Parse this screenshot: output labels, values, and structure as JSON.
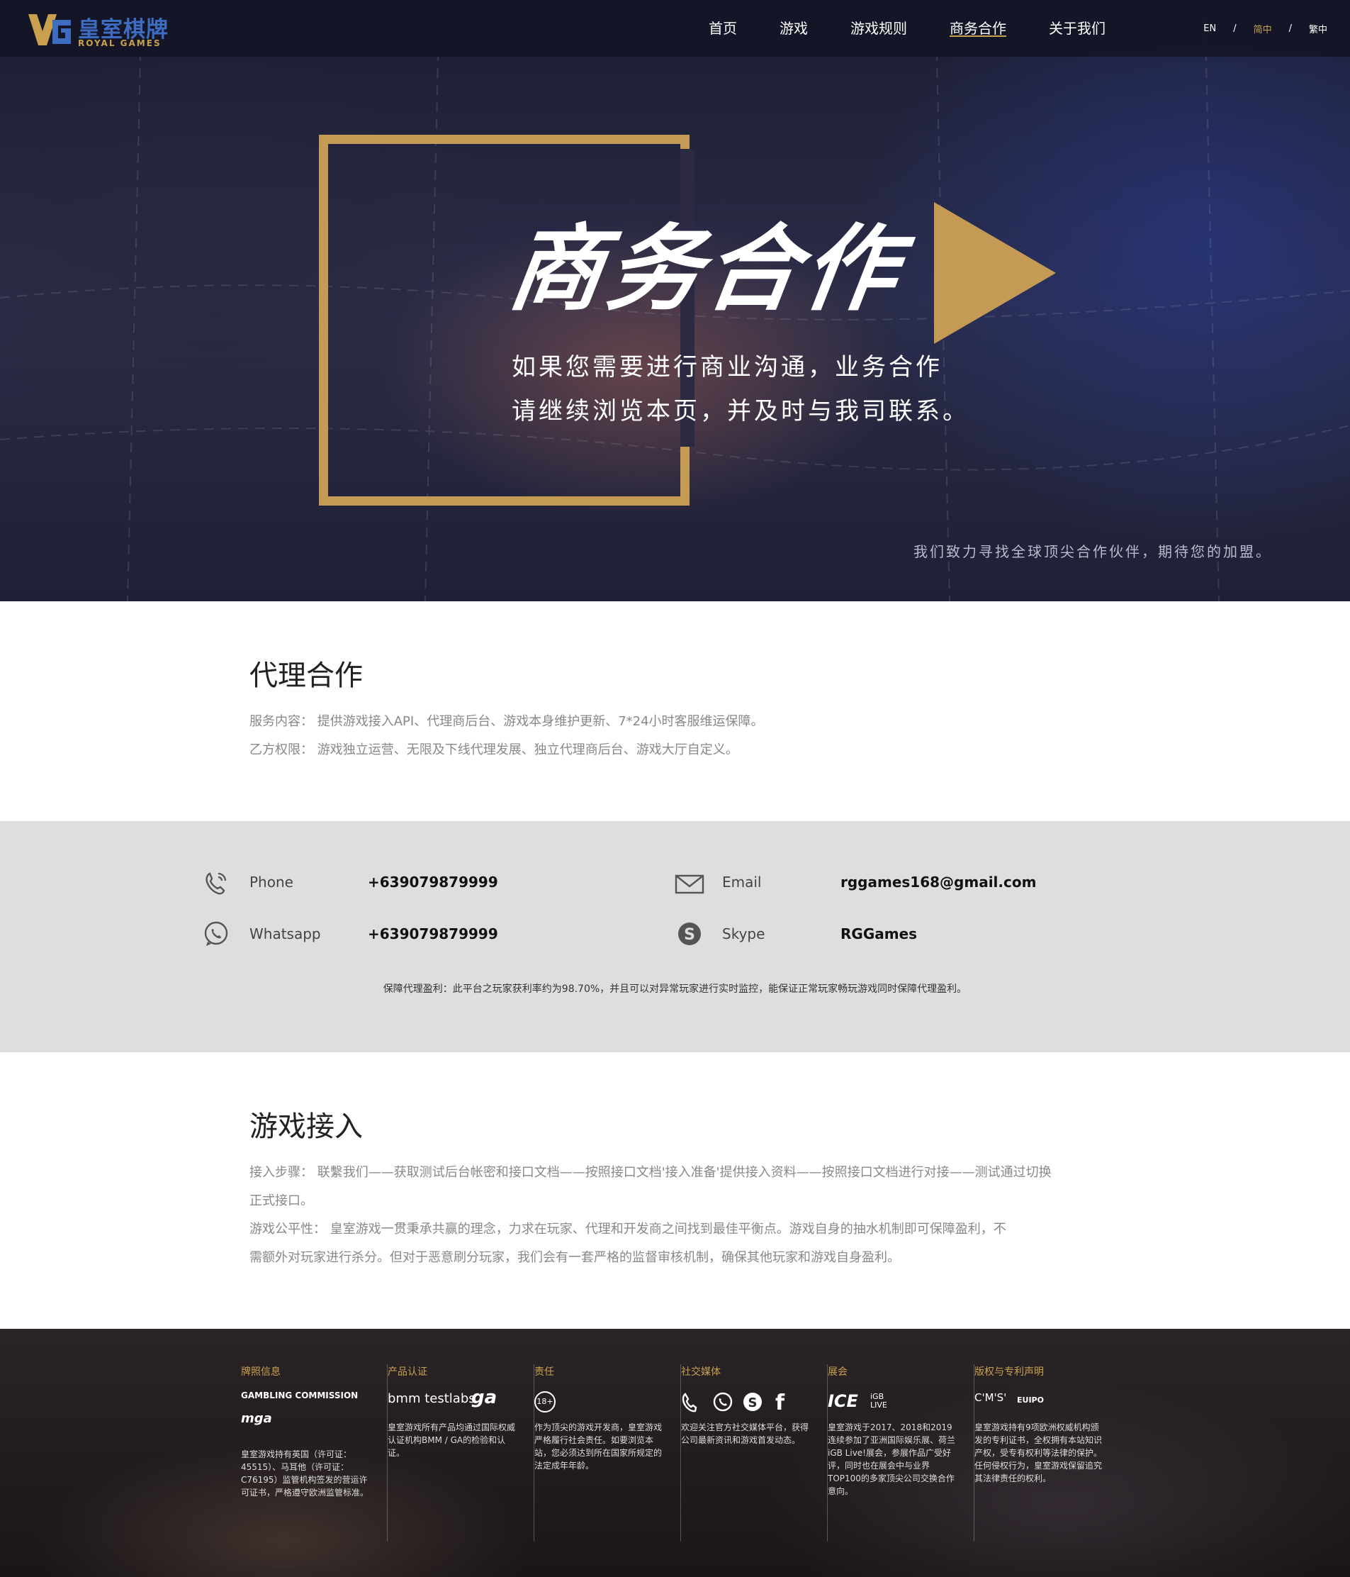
{
  "header": {
    "logo_cn": "皇室棋牌",
    "logo_en": "ROYAL GAMES",
    "nav": [
      "首页",
      "游戏",
      "游戏规则",
      "商务合作",
      "关于我们"
    ],
    "active_nav": "商务合作",
    "lang": [
      "EN",
      "/",
      "简中",
      "/",
      "繁中"
    ]
  },
  "hero": {
    "title": "商务合作",
    "line1": "如果您需要进行商业沟通，业务合作",
    "line2": "请继续浏览本页，并及时与我司联系。",
    "subtitle": "我们致力寻找全球顶尖合作伙伴，期待您的加盟。"
  },
  "agency": {
    "title": "代理合作",
    "line1": "服务内容： 提供游戏接入API、代理商后台、游戏本身维护更新、7*24小时客服维运保障。",
    "line2": "乙方权限： 游戏独立运营、无限及下线代理发展、独立代理商后台、游戏大厅自定义。"
  },
  "contact": {
    "phone_label": "Phone",
    "phone_value": "+639079879999",
    "whatsapp_label": "Whatsapp",
    "whatsapp_value": "+639079879999",
    "email_label": "Email",
    "email_value": "rggames168@gmail.com",
    "skype_label": "Skype",
    "skype_value": "RGGames",
    "note": "保障代理盈利：此平台之玩家获利率约为98.70%，并且可以对异常玩家进行实时监控，能保证正常玩家畅玩游戏同时保障代理盈利。"
  },
  "integration": {
    "title": "游戏接入",
    "line1": "接入步骤： 联繫我们——获取测试后台帐密和接口文档——按照接口文档'接入准备'提供接入资料——按照接口文档进行对接——测试通过切换",
    "line2": "正式接口。",
    "line3": "游戏公平性： 皇室游戏一贯秉承共赢的理念，力求在玩家、代理和开发商之间找到最佳平衡点。游戏自身的抽水机制即可保障盈利，不",
    "line4": "需额外对玩家进行杀分。但对于恶意刷分玩家，我们会有一套严格的监督审核机制，确保其他玩家和游戏自身盈利。"
  },
  "footer": {
    "cols": [
      {
        "head": "牌照信息",
        "logo": "GAMBLING COMMISSION",
        "logo2": "mga",
        "body": "皇室游戏持有英国（许可证：45515）、马耳他（许可证：C76195）监管机构签发的营运许可证书，严格遵守欧洲监管标准。"
      },
      {
        "head": "产品认证",
        "logo": "bmm testlabs",
        "logo2": "ga",
        "body": "皇室游戏所有产品均通过国际权威认证机构BMM / GA的检验和认证。"
      },
      {
        "head": "责任",
        "logo": "18+",
        "logo2": "",
        "body": "作为顶尖的游戏开发商，皇室游戏严格履行社会责任。如要浏览本站，您必须达到所在国家所规定的法定成年年龄。"
      },
      {
        "head": "社交媒体",
        "logo": "",
        "logo2": "",
        "body": "欢迎关注官方社交媒体平台，获得公司最新资讯和游戏首发动态。"
      },
      {
        "head": "展会",
        "logo": "ICE",
        "logo2": "iGB LIVE",
        "body": "皇室游戏于2017、2018和2019连续参加了亚洲国际娱乐展、荷兰iGB Live!展会，参展作品广受好评，同时也在展会中与业界TOP100的多家顶尖公司交换合作意向。"
      },
      {
        "head": "版权与专利声明",
        "logo": "C'M'S'",
        "logo2": "EUIPO",
        "body": "皇室游戏持有9项欧洲权威机构颁发的专利证书，全权拥有本站知识产权，受专有权利等法律的保护。任何侵权行为，皇室游戏保留追究其法律责任的权利。"
      }
    ],
    "accent": "#c9a14e"
  }
}
